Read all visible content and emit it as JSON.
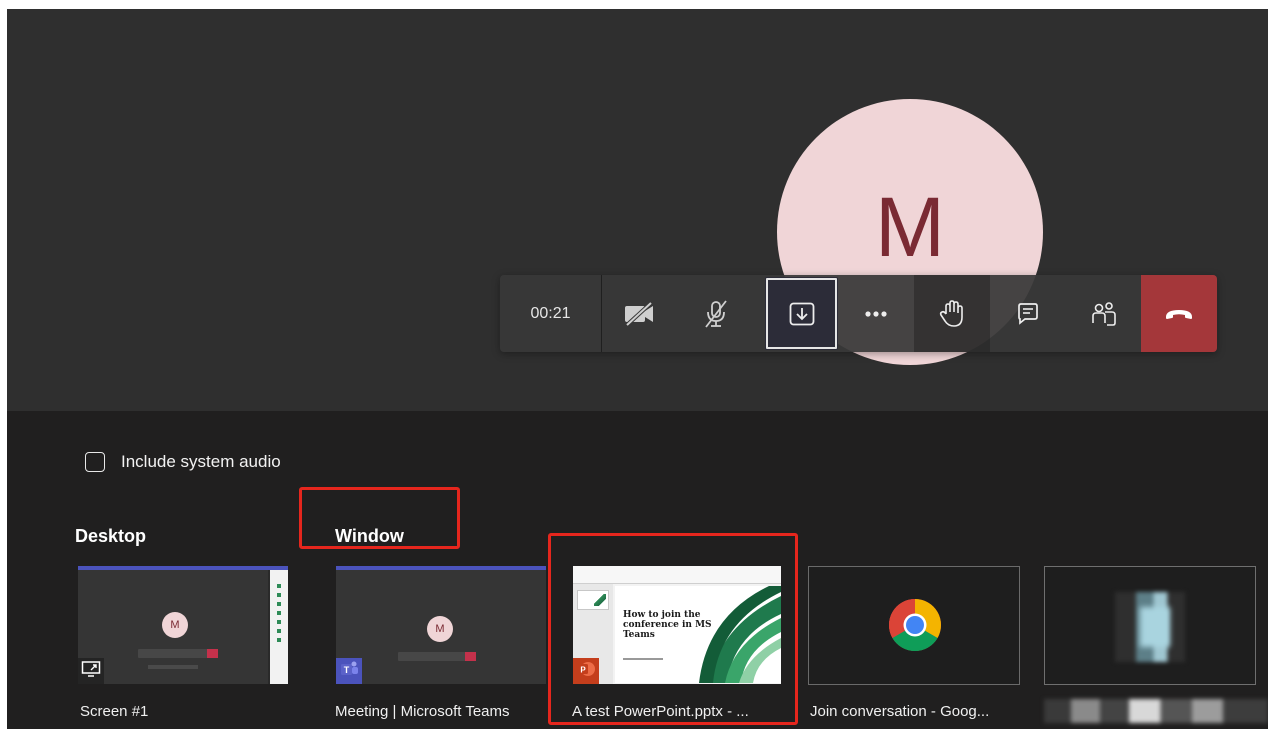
{
  "meeting": {
    "participant_initial": "M",
    "avatar_color": "#f0d5d7",
    "initial_color": "#7a2a33"
  },
  "controls": {
    "timer": "00:21",
    "buttons": [
      {
        "name": "camera-off",
        "icon": "video-off-icon"
      },
      {
        "name": "mic-off",
        "icon": "mic-off-icon"
      },
      {
        "name": "share-tray",
        "icon": "share-screen-icon",
        "active": true
      },
      {
        "name": "more-actions",
        "icon": "more-icon"
      },
      {
        "name": "raise-hand",
        "icon": "hand-icon"
      },
      {
        "name": "chat",
        "icon": "chat-icon"
      },
      {
        "name": "participants",
        "icon": "people-icon"
      },
      {
        "name": "hang-up",
        "icon": "phone-hangup-icon",
        "color": "#a4373a"
      }
    ]
  },
  "share_tray": {
    "include_audio_label": "Include system audio",
    "include_audio_checked": false,
    "sections": {
      "desktop": "Desktop",
      "window": "Window"
    },
    "items": [
      {
        "label": "Screen #1",
        "type": "desktop"
      },
      {
        "label": "Meeting | Microsoft Teams",
        "type": "window",
        "mini_initial": "M"
      },
      {
        "label": "A test PowerPoint.pptx - ...",
        "type": "window",
        "slide_title": "How to join the conference in MS Teams"
      },
      {
        "label": "Join conversation - Goog...",
        "type": "window"
      },
      {
        "label": "",
        "type": "window"
      }
    ],
    "highlight_color": "#e5261d"
  }
}
